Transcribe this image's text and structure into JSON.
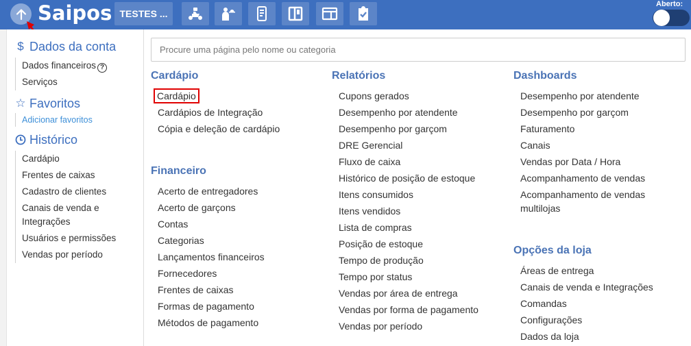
{
  "header": {
    "logo": "Saipos",
    "store_button": "TESTES ...",
    "toggle_label": "Aberto:",
    "tools": [
      {
        "name": "delivery-tool",
        "icon": "delivery-moto-icon"
      },
      {
        "name": "waiter-tool",
        "icon": "waiter-icon"
      },
      {
        "name": "phone-order-tool",
        "icon": "phone-order-icon"
      },
      {
        "name": "kanban-tool",
        "icon": "kanban-icon"
      },
      {
        "name": "layout-tool",
        "icon": "layout-icon"
      },
      {
        "name": "checklist-tool",
        "icon": "clipboard-check-icon"
      }
    ],
    "colors": {
      "bar": "#3d6fbf",
      "button": "#5c85c8"
    }
  },
  "sidebar": {
    "account": {
      "title": "Dados da conta",
      "items": [
        "Dados financeiros",
        "Serviços"
      ]
    },
    "favorites": {
      "title": "Favoritos",
      "link": "Adicionar favoritos"
    },
    "history": {
      "title": "Histórico",
      "items": [
        "Cardápio",
        "Frentes de caixas",
        "Cadastro de clientes",
        "Canais de venda e Integrações",
        "Usuários e permissões",
        "Vendas por período"
      ]
    }
  },
  "search": {
    "placeholder": "Procure uma página pelo nome ou categoria"
  },
  "categories": {
    "cardapio": {
      "title": "Cardápio",
      "items": [
        "Cardápio",
        "Cardápios de Integração",
        "Cópia e deleção de cardápio"
      ]
    },
    "financeiro": {
      "title": "Financeiro",
      "items": [
        "Acerto de entregadores",
        "Acerto de garçons",
        "Contas",
        "Categorias",
        "Lançamentos financeiros",
        "Fornecedores",
        "Frentes de caixas",
        "Formas de pagamento",
        "Métodos de pagamento"
      ]
    },
    "relatorios": {
      "title": "Relatórios",
      "items": [
        "Cupons gerados",
        "Desempenho por atendente",
        "Desempenho por garçom",
        "DRE Gerencial",
        "Fluxo de caixa",
        "Histórico de posição de estoque",
        "Itens consumidos",
        "Itens vendidos",
        "Lista de compras",
        "Posição de estoque",
        "Tempo de produção",
        "Tempo por status",
        "Vendas por área de entrega",
        "Vendas por forma de pagamento",
        "Vendas por período"
      ]
    },
    "dashboards": {
      "title": "Dashboards",
      "items": [
        "Desempenho por atendente",
        "Desempenho por garçom",
        "Faturamento",
        "Canais",
        "Vendas por Data / Hora",
        "Acompanhamento de vendas",
        "Acompanhamento de vendas multilojas"
      ]
    },
    "opcoes": {
      "title": "Opções da loja",
      "items": [
        "Áreas de entrega",
        "Canais de venda e Integrações",
        "Comandas",
        "Configurações",
        "Dados da loja"
      ]
    }
  }
}
